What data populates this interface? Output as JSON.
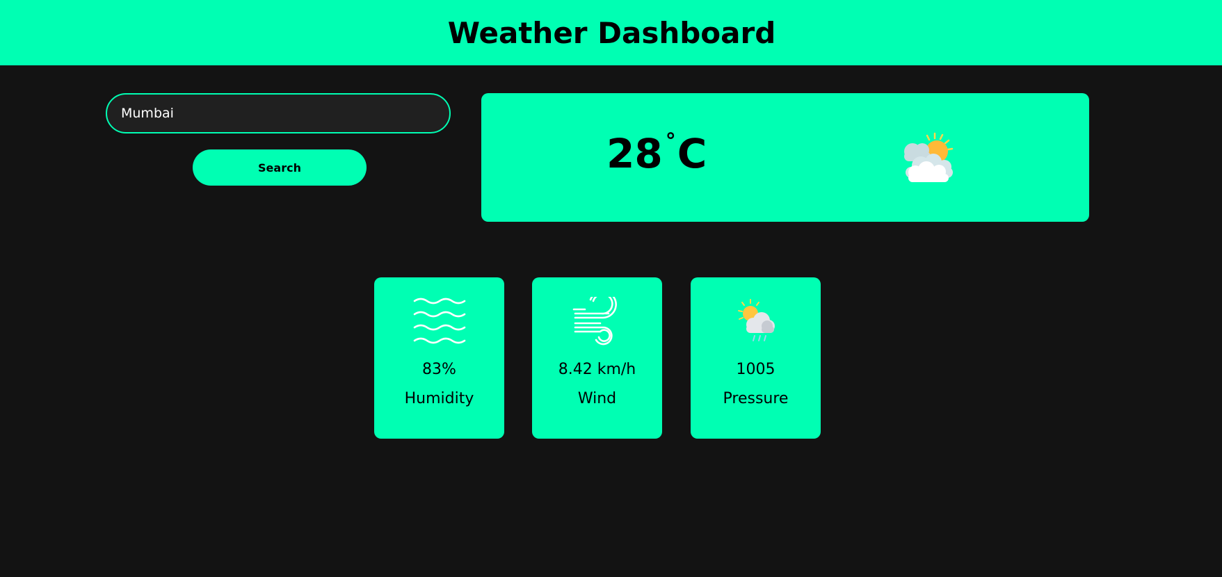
{
  "header": {
    "title": "Weather Dashboard"
  },
  "search": {
    "value": "Mumbai",
    "button_label": "Search"
  },
  "current": {
    "temperature": "28",
    "degree_symbol": "°",
    "unit": "C",
    "icon": "partly-cloudy-icon"
  },
  "stats": [
    {
      "icon": "humidity-waves-icon",
      "value": "83%",
      "label": "Humidity"
    },
    {
      "icon": "wind-icon",
      "value": "8.42 km/h",
      "label": "Wind"
    },
    {
      "icon": "cloud-sun-rain-icon",
      "value": "1005",
      "label": "Pressure"
    }
  ],
  "colors": {
    "accent": "#00ffb3",
    "background": "#131313",
    "input_background": "#202020"
  }
}
